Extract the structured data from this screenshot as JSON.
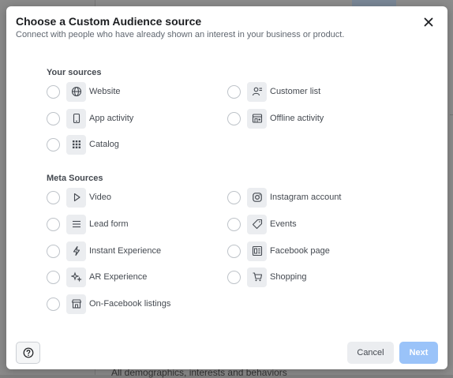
{
  "modal": {
    "title": "Choose a Custom Audience source",
    "subtitle": "Connect with people who have already shown an interest in your business or product."
  },
  "your_sources": {
    "heading": "Your sources",
    "items": [
      {
        "label": "Website",
        "icon": "globe-icon"
      },
      {
        "label": "Customer list",
        "icon": "customer-list-icon"
      },
      {
        "label": "App activity",
        "icon": "mobile-phone-icon"
      },
      {
        "label": "Offline activity",
        "icon": "offline-store-icon"
      },
      {
        "label": "Catalog",
        "icon": "grid-icon"
      }
    ]
  },
  "meta_sources": {
    "heading": "Meta Sources",
    "items": [
      {
        "label": "Video",
        "icon": "play-icon"
      },
      {
        "label": "Instagram account",
        "icon": "instagram-icon"
      },
      {
        "label": "Lead form",
        "icon": "list-lines-icon"
      },
      {
        "label": "Events",
        "icon": "ticket-icon"
      },
      {
        "label": "Instant Experience",
        "icon": "lightning-icon"
      },
      {
        "label": "Facebook page",
        "icon": "facebook-page-icon"
      },
      {
        "label": "AR Experience",
        "icon": "sparkle-icon"
      },
      {
        "label": "Shopping",
        "icon": "shopping-cart-icon"
      },
      {
        "label": "On-Facebook listings",
        "icon": "storefront-icon"
      }
    ]
  },
  "footer": {
    "help_icon": "question-circle-icon",
    "cancel_label": "Cancel",
    "next_label": "Next"
  },
  "background": {
    "footer_text": "All demographics, interests and behaviors"
  },
  "colors": {
    "next_disabled": "#9ac3f9",
    "icon_box": "#ebedf0",
    "radio_border": "#bec3c9"
  }
}
